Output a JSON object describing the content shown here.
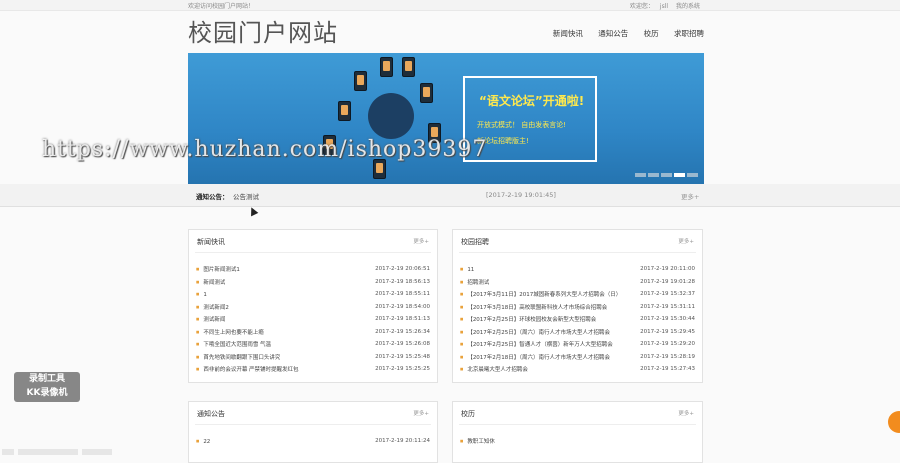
{
  "topbar": {
    "welcome": "欢迎访问校园门户网站！",
    "hello": "欢迎您：",
    "user": "jsll",
    "account": "我的系统"
  },
  "site": {
    "title": "校园门户网站"
  },
  "nav": [
    {
      "label": "新闻快讯"
    },
    {
      "label": "通知公告"
    },
    {
      "label": "校历"
    },
    {
      "label": "求职招聘"
    }
  ],
  "banner": {
    "headline": "“语文论坛”开通啦!",
    "line1": "开放式模式！ 自由发表言论!",
    "line2": "新论坛招聘版主!"
  },
  "watermark": "https://www.huzhan.com/ishop39397",
  "notice": {
    "label": "通知公告：",
    "text": "公告测试",
    "date": "[2017-2-19 19:01:45]",
    "more": "更多+"
  },
  "panels": {
    "news": {
      "title": "新闻快讯",
      "more": "更多+",
      "items": [
        {
          "t": "图片新闻测试1",
          "d": "2017-2-19 20:06:51"
        },
        {
          "t": "新闻测试",
          "d": "2017-2-19 18:56:13"
        },
        {
          "t": "1",
          "d": "2017-2-19 18:55:11"
        },
        {
          "t": "测试新闻2",
          "d": "2017-2-19 18:54:00"
        },
        {
          "t": "测试新闻",
          "d": "2017-2-19 18:51:13"
        },
        {
          "t": "不同生上网也要不能上瘾",
          "d": "2017-2-19 15:26:34"
        },
        {
          "t": "下哦全国近大范围雨雪 气温",
          "d": "2017-2-19 15:26:08"
        },
        {
          "t": "首先地铁间歇翻跟下围口头讲究",
          "d": "2017-2-19 15:25:48"
        },
        {
          "t": "西非前的会议开幕 严禁铺时提醒发红包",
          "d": "2017-2-19 15:25:25"
        }
      ]
    },
    "recruit": {
      "title": "校园招聘",
      "more": "更多+",
      "items": [
        {
          "t": "11",
          "d": "2017-2-19 20:11:00"
        },
        {
          "t": "招聘测试",
          "d": "2017-2-19 19:01:28"
        },
        {
          "t": "【2017年3月11日】2017城固新春系列大型人才招聘会（日）",
          "d": "2017-2-19 15:32:37"
        },
        {
          "t": "【2017年3月18日】高校联盟新科技人才市场综合招聘会",
          "d": "2017-2-19 15:31:11"
        },
        {
          "t": "【2017年2月25日】环球校园校友会新型大型招聘会",
          "d": "2017-2-19 15:30:44"
        },
        {
          "t": "【2017年2月25日】（周六）南行人才市场大型人才招聘会",
          "d": "2017-2-19 15:29:45"
        },
        {
          "t": "【2017年2月25日】智通人才（横茵）新年万人大型招聘会",
          "d": "2017-2-19 15:29:20"
        },
        {
          "t": "【2017年2月18日】（周六）南行人才市场大型人才招聘会",
          "d": "2017-2-19 15:28:19"
        },
        {
          "t": "北京晨曦大型人才招聘会",
          "d": "2017-2-19 15:27:43"
        }
      ]
    },
    "notices": {
      "title": "通知公告",
      "more": "更多+",
      "items": [
        {
          "t": "22",
          "d": "2017-2-19 20:11:24"
        }
      ]
    },
    "calendar": {
      "title": "校历",
      "more": "更多+",
      "items": [
        {
          "t": "教职工知休",
          "d": ""
        }
      ]
    }
  },
  "overlay": {
    "kk_line1": "录制工具",
    "kk_line2": "KK录像机"
  }
}
